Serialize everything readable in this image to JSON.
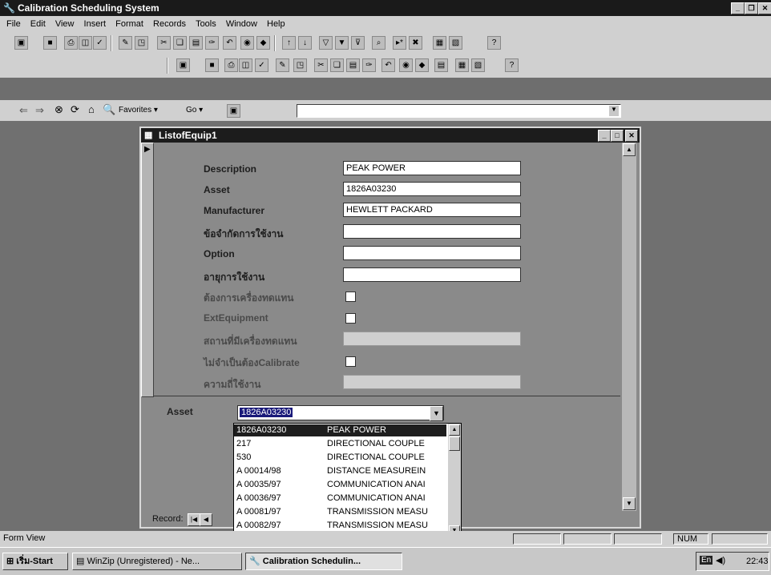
{
  "app": {
    "title": "Calibration Scheduling System"
  },
  "menu": [
    "File",
    "Edit",
    "View",
    "Insert",
    "Format",
    "Records",
    "Tools",
    "Window",
    "Help"
  ],
  "nav": {
    "favorites": "Favorites ▾",
    "go": "Go ▾"
  },
  "form": {
    "title": "ListofEquip1",
    "fields": [
      {
        "label": "Description",
        "value": "PEAK POWER",
        "type": "text"
      },
      {
        "label": "Asset",
        "value": "1826A03230",
        "type": "text"
      },
      {
        "label": "Manufacturer",
        "value": "HEWLETT PACKARD",
        "type": "text"
      },
      {
        "label": "ข้อจำกัดการใช้งาน",
        "value": "",
        "type": "text"
      },
      {
        "label": "Option",
        "value": "",
        "type": "text"
      },
      {
        "label": "อายุการใช้งาน",
        "value": "",
        "type": "text"
      },
      {
        "label": "ต้องการเครื่องทดแทน",
        "value": "",
        "type": "check"
      },
      {
        "label": "ExtEquipment",
        "value": "",
        "type": "check"
      },
      {
        "label": "สถานที่มีเครื่องทดแทน",
        "value": "",
        "type": "text"
      },
      {
        "label": "ไม่จำเป็นต้องCalibrate",
        "value": "",
        "type": "check"
      },
      {
        "label": "ความถี่ใช้งาน",
        "value": "",
        "type": "text"
      }
    ],
    "combo": {
      "label": "Asset",
      "value": "1826A03230"
    },
    "dropdown": [
      {
        "asset": "1826A03230",
        "desc": "PEAK POWER"
      },
      {
        "asset": "217",
        "desc": "DIRECTIONAL COUPLE"
      },
      {
        "asset": "530",
        "desc": "DIRECTIONAL COUPLE"
      },
      {
        "asset": "A 00014/98",
        "desc": "DISTANCE MEASUREIN"
      },
      {
        "asset": "A 00035/97",
        "desc": "COMMUNICATION ANAI"
      },
      {
        "asset": "A 00036/97",
        "desc": "COMMUNICATION ANAI"
      },
      {
        "asset": "A 00081/97",
        "desc": "TRANSMISSION MEASU"
      },
      {
        "asset": "A 00082/97",
        "desc": "TRANSMISSION MEASU"
      }
    ],
    "record_label": "Record:"
  },
  "status": {
    "text": "Form View",
    "num": "NUM"
  },
  "taskbar": {
    "start": "เริ่ม-Start",
    "tasks": [
      "WinZip (Unregistered) - Ne...",
      "Calibration Schedulin..."
    ],
    "time": "22:43"
  }
}
